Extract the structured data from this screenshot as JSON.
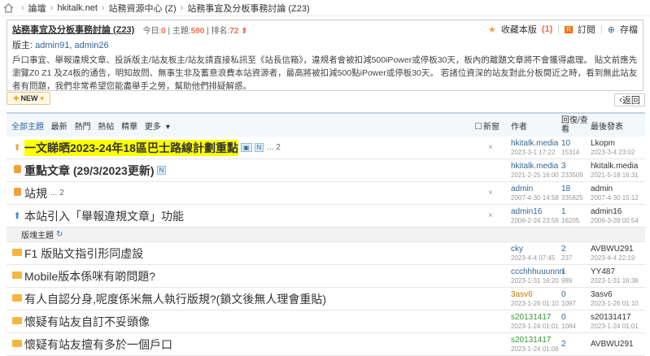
{
  "breadcrumb": {
    "items": [
      "論壇",
      "hkitalk.net",
      "站務資源中心 (Z)",
      "站務事宜及分板事務討論 (Z23)"
    ]
  },
  "forum": {
    "title": "站務事宜及分板事務討論 (Z23)",
    "today_label": "今日:",
    "today": "0",
    "topics_label": "主題:",
    "topics": "590",
    "rank_label": "排名:",
    "rank": "72",
    "fav_label": "收藏本版",
    "fav_count": "(1)",
    "subscribe": "訂閱",
    "archive": "存檔",
    "mods_label": "版主:",
    "mods": "admin91, admin26",
    "rules": "戶口事宜、舉報違規文章、投訴版主/站友板主/站友請直接私訊至《站長信箱》，違規者會被扣減500iPower或停板30天，板內的離題文章將不會獲得處理。 貼文前應先瀏覽Z0 Z1 及Z4板的通告，明知故問、無事生非及蓄意浪費本站資源者，最高將被扣減500點iPower或停板30天。 若諸位資深的站友對此分板閱近之時，看到無此站友者有問題，我們非常希望您能盡舉手之勞，幫助他們排疑解惑。"
  },
  "toolbar": {
    "new": "NEW",
    "back": "返回"
  },
  "tabs": {
    "all": "全部主題",
    "latest": "最新",
    "hot": "熱門",
    "hotpost": "熱帖",
    "digest": "精華",
    "more": "更多",
    "newwin": "新窗",
    "author": "作者",
    "replies": "回復/查看",
    "last": "最後發表"
  },
  "section": "版塊主題",
  "rows": [
    {
      "title": "一文睇晒2023-24年18區巴士路線計劃重點",
      "pages": "... 2",
      "author": "hkitalk.media",
      "date": "2023-3-1 17:22",
      "replies": "10",
      "views": "15314",
      "last": "Lkopm",
      "last_date": "2023-3-4 23:02"
    },
    {
      "title": "重點文章 (29/3/2023更新)",
      "pages": "",
      "author": "hkitalk.media",
      "date": "2021-2-25 16:00",
      "replies": "3",
      "views": "233509",
      "last": "hkitalk.media",
      "last_date": "2021-5-18 16:31"
    },
    {
      "title": "站規",
      "pages": "... 2",
      "author": "admin",
      "date": "2007-4-30 14:58",
      "replies": "18",
      "views": "335825",
      "last": "admin",
      "last_date": "2007-4-30 15:12"
    },
    {
      "title": "本站引入「舉報違規文章」功能",
      "pages": "",
      "author": "admin16",
      "date": "2006-2-24 23:59",
      "replies": "1",
      "views": "16205",
      "last": "admin16",
      "last_date": "2006-3-28 00:54"
    },
    {
      "title": "F1 版貼文指引形同虛設",
      "pages": "",
      "author": "cky",
      "date": "2023-4-4 07:45",
      "replies": "2",
      "views": "237",
      "last": "AVBWU291",
      "last_date": "2023-4-4 22:19"
    },
    {
      "title": "Mobile版本係咪有啲問題?",
      "pages": "",
      "author": "ccchhhuuunnn",
      "date": "2023-1-31 16:20",
      "replies": "1",
      "views": "989",
      "last": "YY487",
      "last_date": "2023-1-31 16:38"
    },
    {
      "title": "有人自認分身,呢度係米無人執行版規?(鎖文後無人理會重貼)",
      "pages": "",
      "author": "3asv6",
      "date": "2023-1-26 01:10",
      "replies": "0",
      "views": "1097",
      "last": "3asv6",
      "last_date": "2023-1-26 01:10"
    },
    {
      "title": "懷疑有站友自訂不妥頭像",
      "pages": "",
      "author": "s20131417",
      "date": "2023-1-24 01:01",
      "replies": "0",
      "views": "1084",
      "last": "s20131417",
      "last_date": "2023-1-24 01:01"
    },
    {
      "title": "懷疑有站友擅有多於一個戶口",
      "pages": "",
      "author": "s20131417",
      "date": "2023-1-24 01:06",
      "replies": "2",
      "views": "",
      "last": "AVBWU291",
      "last_date": ""
    }
  ]
}
